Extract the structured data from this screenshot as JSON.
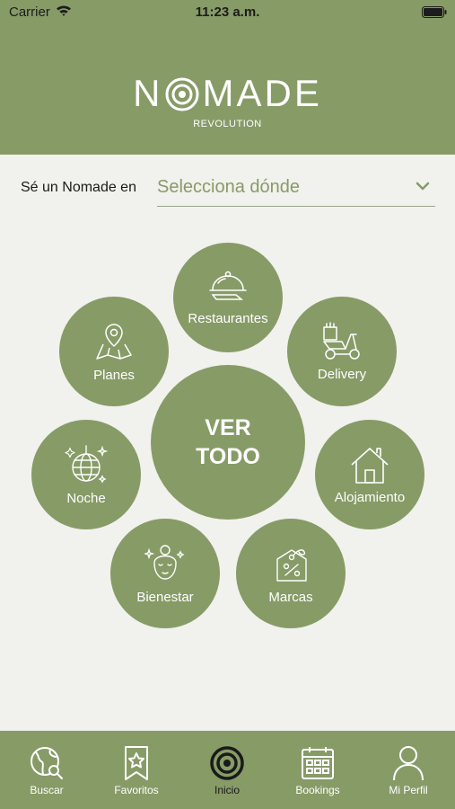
{
  "status_bar": {
    "carrier": "Carrier",
    "time": "11:23 a.m."
  },
  "logo": {
    "left_text": "N",
    "right_text": "MADE",
    "subtitle": "REVOLUTION"
  },
  "selector": {
    "label": "Sé un Nomade en",
    "value": "Selecciona dónde"
  },
  "categories": {
    "restaurantes": "Restaurantes",
    "planes": "Planes",
    "delivery": "Delivery",
    "ver_todo": "VER TODO",
    "noche": "Noche",
    "alojamiento": "Alojamiento",
    "bienestar": "Bienestar",
    "marcas": "Marcas"
  },
  "tabs": {
    "buscar": "Buscar",
    "favoritos": "Favoritos",
    "inicio": "Inicio",
    "bookings": "Bookings",
    "mi_perfil": "Mi Perfil"
  },
  "colors": {
    "brand_green": "#879b67",
    "background": "#f1f1ed",
    "active_tab": "#1a1a1a"
  },
  "active_tab": "inicio"
}
